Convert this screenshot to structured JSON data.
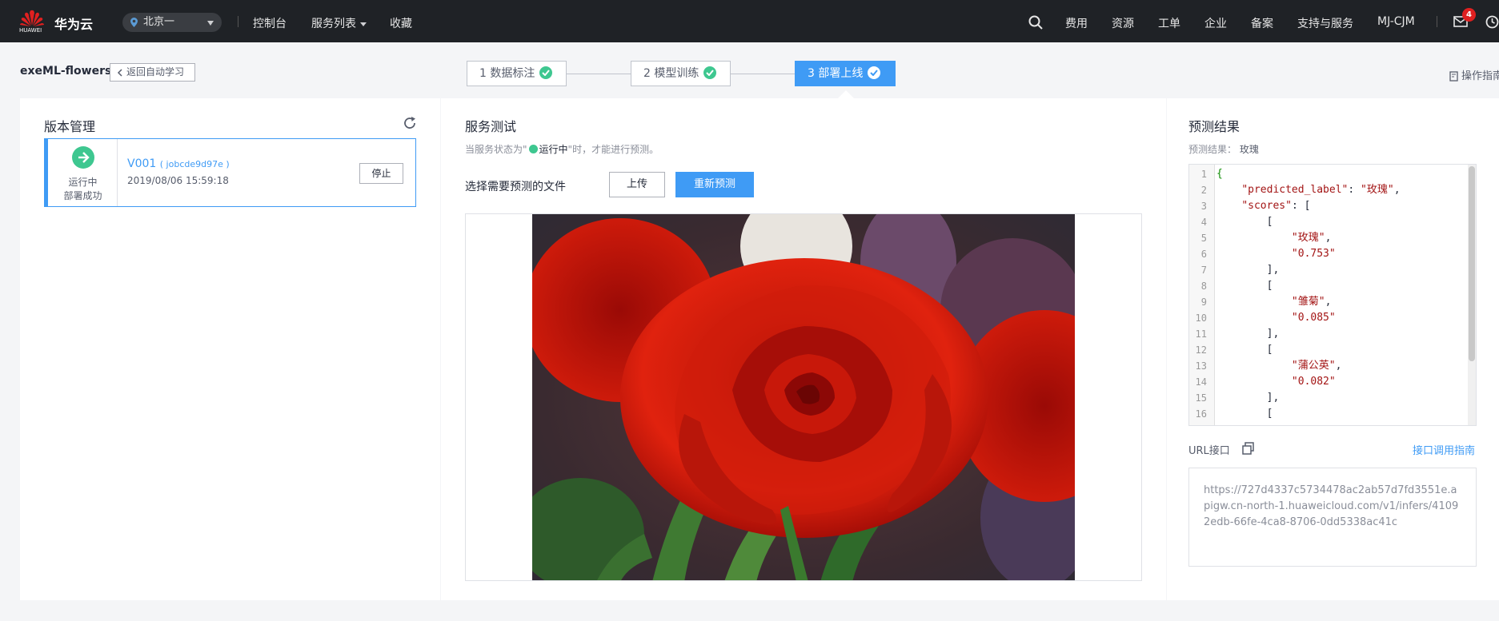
{
  "topbar": {
    "logo_text": "HUAWEI",
    "brand": "华为云",
    "region": "北京一",
    "nav_left": [
      "控制台",
      "服务列表",
      "收藏"
    ],
    "nav_right": [
      "费用",
      "资源",
      "工单",
      "企业",
      "备案",
      "支持与服务",
      "MJ-CJM"
    ],
    "mail_badge": "4"
  },
  "subheader": {
    "project_title": "exeML-flowers",
    "back_label": "返回自动学习",
    "steps": [
      {
        "label": "1 数据标注",
        "done": true
      },
      {
        "label": "2 模型训练",
        "done": true
      },
      {
        "label": "3 部署上线",
        "done": true,
        "active": true
      }
    ],
    "guide_label": "操作指南"
  },
  "version_panel": {
    "title": "版本管理",
    "card": {
      "status1": "运行中",
      "status2": "部署成功",
      "name": "V001",
      "job": "( jobcde9d97e )",
      "time": "2019/08/06 15:59:18",
      "stop_label": "停止"
    }
  },
  "service_panel": {
    "title": "服务测试",
    "hint_prefix": "当服务状态为\"",
    "hint_status": "运行中",
    "hint_suffix": "\"时，才能进行预测。",
    "file_label": "选择需要预测的文件",
    "upload_label": "上传",
    "repredict_label": "重新预测"
  },
  "result_panel": {
    "title": "预测结果",
    "result_prefix": "预测结果：",
    "result_value": "玫瑰",
    "code_lines": [
      "{",
      "    \"predicted_label\": \"玫瑰\",",
      "    \"scores\": [",
      "        [",
      "            \"玫瑰\",",
      "            \"0.753\"",
      "        ],",
      "        [",
      "            \"雏菊\",",
      "            \"0.085\"",
      "        ],",
      "        [",
      "            \"蒲公英\",",
      "            \"0.082\"",
      "        ],",
      "        ["
    ],
    "url_label": "URL接口",
    "api_guide_label": "接口调用指南",
    "url_value": "https://727d4337c5734478ac2ab57d7fd3551e.apigw.cn-north-1.huaweicloud.com/v1/infers/41092edb-66fe-4ca8-8706-0dd5338ac41c"
  },
  "colors": {
    "primary": "#3f9bf5",
    "success": "#3ec790",
    "topbar": "#1f2226",
    "badge": "#e02020"
  }
}
